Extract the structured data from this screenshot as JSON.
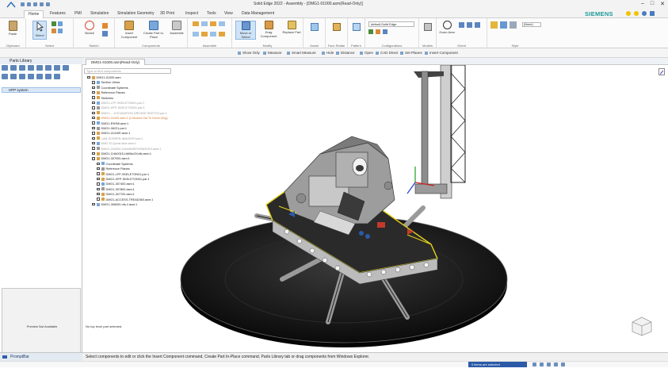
{
  "window": {
    "title": "Solid Edge 2022 - Assembly - [DMG1-01000.asm(Read-Only)]",
    "brand": "SIEMENS",
    "controls": [
      "–",
      "□",
      "✕"
    ]
  },
  "menu": {
    "tabs": [
      "Home",
      "Features",
      "PMI",
      "Simulation",
      "Simulation Geometry",
      "3D Print",
      "Inspect",
      "Tools",
      "View",
      "Data Management"
    ],
    "active": "Home"
  },
  "ribbon": {
    "groups": [
      {
        "label": "Clipboard",
        "buttons": [
          "Paste"
        ]
      },
      {
        "label": "Select",
        "buttons": [
          "Select"
        ]
      },
      {
        "label": "Sketch",
        "buttons": [
          "Sketch"
        ]
      },
      {
        "label": "Components",
        "buttons": [
          "Insert Component",
          "Create Part In-Place",
          "Assemble"
        ]
      },
      {
        "label": "Assemble",
        "buttons": []
      },
      {
        "label": "Modify",
        "buttons": [
          "Move or Select",
          "Drag Component",
          "Replace Part"
        ]
      },
      {
        "label": "Assist",
        "buttons": []
      },
      {
        "label": "Face Relate",
        "buttons": []
      },
      {
        "label": "Pattern",
        "buttons": []
      },
      {
        "label": "Configurations",
        "buttons": []
      },
      {
        "label": "Models",
        "buttons": []
      },
      {
        "label": "Orient",
        "buttons": [
          "Zoom Area"
        ]
      },
      {
        "label": "Style",
        "buttons": []
      }
    ],
    "config_dropdown": "default,Solid Edge",
    "style_dropdown": "(None)"
  },
  "commandbar": {
    "items": [
      "Show Only",
      "Measure",
      "Smart Measure",
      "Hide",
      "Distance",
      "Open",
      "CAD Direct",
      "Set Planes",
      "Insert Component"
    ]
  },
  "parts_library": {
    "title": "Parts Library",
    "header": "HPP system",
    "preview": "Preview Not Available"
  },
  "document": {
    "tab": "DMG1-01000.asm(Read-Only)",
    "search_placeholder": "Type to find components",
    "status": "No top level part selected."
  },
  "tree": [
    {
      "text": "DMG1-01000.asm",
      "indent": 0,
      "style": "normal"
    },
    {
      "text": "Section Views",
      "indent": 1,
      "style": "normal"
    },
    {
      "text": "Coordinate Systems",
      "indent": 1,
      "style": "normal"
    },
    {
      "text": "Reference Planes",
      "indent": 1,
      "style": "normal"
    },
    {
      "text": "Sketches",
      "indent": 1,
      "style": "normal"
    },
    {
      "text": "DMG1-LFP-SKELETON01.par:1",
      "indent": 1,
      "style": "gray"
    },
    {
      "text": "DMG1-HFP-SKELETON01.par:1",
      "indent": 1,
      "style": "gray"
    },
    {
      "text": "DMG1-...-EXCAVATION DRIVING SKETCH.par:1",
      "indent": 1,
      "style": "gray"
    },
    {
      "text": "DMG1-01000.asm:1 (Checked Out To Kevin King)",
      "indent": 1,
      "style": "orange"
    },
    {
      "text": "DMG1-E9058.asm:1",
      "indent": 1,
      "style": "normal"
    },
    {
      "text": "DMG1-06221.par:1",
      "indent": 1,
      "style": "normal"
    },
    {
      "text": "DMG1-01410E.asm:1",
      "indent": 1,
      "style": "normal"
    },
    {
      "text": "LAM-SCREEN-IMAGERY.par:1",
      "indent": 1,
      "style": "gray"
    },
    {
      "text": "DMG SI-Quest blue.asm:1",
      "indent": 1,
      "style": "gray"
    },
    {
      "text": "DMG1-010000-GHASMDPHONGEKS.asm:1",
      "indent": 1,
      "style": "gray"
    },
    {
      "text": "DMG1-CrtA0015-UkMkcCKcikt.asm:1",
      "indent": 1,
      "style": "normal"
    },
    {
      "text": "DMG1-307000.asm:1",
      "indent": 1,
      "style": "normal"
    },
    {
      "text": "Coordinate Systems",
      "indent": 2,
      "style": "normal"
    },
    {
      "text": "Reference Planes",
      "indent": 2,
      "style": "normal"
    },
    {
      "text": "DMG1-LFP-SKELETON01.par:1",
      "indent": 2,
      "style": "normal"
    },
    {
      "text": "DMG1-HFP-SKELETON01.par:1",
      "indent": 2,
      "style": "normal"
    },
    {
      "text": "DMG1-307400.asm:1",
      "indent": 2,
      "style": "normal"
    },
    {
      "text": "DMG1-307800.asm:1",
      "indent": 2,
      "style": "normal"
    },
    {
      "text": "DMG1-307700.asm:1",
      "indent": 2,
      "style": "normal"
    },
    {
      "text": "DMG1-ACCESS-TREAD360.asm:1",
      "indent": 2,
      "style": "normal"
    },
    {
      "text": "DMG1-306000-nfs.2.asm:1",
      "indent": 1,
      "style": "normal"
    }
  ],
  "prompt": {
    "label": "PromptBar",
    "message": "Select components to edit or click the Insert Component command, Create Part In-Place command, Parts Library tab or drag components from Windows Explorer."
  },
  "status": {
    "items_selected": "0 items are selected"
  },
  "colors": {
    "accent": "#2a5aa8",
    "brand": "#1a9a9a",
    "platform": "#151515",
    "highlight": "#e6d21a"
  }
}
